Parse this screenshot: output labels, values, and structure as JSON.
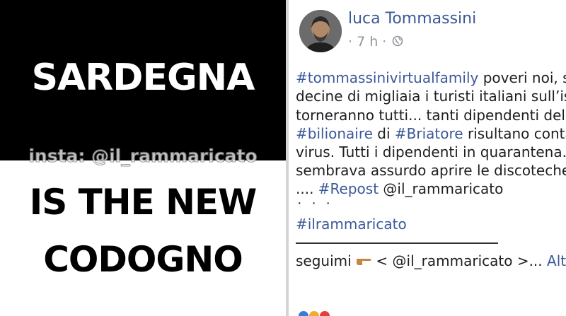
{
  "meme": {
    "line1": "SARDEGNA",
    "watermark": "insta: @il_rammaricato",
    "line2": "IS THE NEW",
    "line3": "CODOGNO"
  },
  "post": {
    "author": "luca Tommassini",
    "time": "· 7 h ·",
    "privacy_icon": "globe-icon",
    "body": {
      "l1_tag": "#tommassinivirtualfamily",
      "l1_text": " poveri noi, sono",
      "l2": "decine di migliaia i turisti italiani sull’isola",
      "l3": "torneranno tutti... tanti dipendenti del",
      "l4_tag1": "#bilionaire",
      "l4_text1": " di ",
      "l4_tag2": "#Briatore",
      "l4_text2": " risultano contagiati dal",
      "l5": "virus. Tutti i dipendenti in quarantena. A me",
      "l6": "sembrava assurdo aprire le discoteche così",
      "l7_text1": ".... ",
      "l7_tag": "#Repost",
      "l7_text2": " @il_rammaricato",
      "dots": "· · ·",
      "l8_tag": "#ilrammaricato"
    },
    "footer": {
      "text1": "seguimi ",
      "hand_icon": "pointing-hand-icon",
      "text2": " < @il_rammaricato >... ",
      "more": "Altro"
    }
  }
}
